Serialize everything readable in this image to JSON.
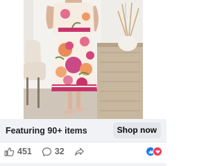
{
  "ad": {
    "headline": "Featuring 90+ items",
    "cta_label": "Shop now"
  },
  "engagement": {
    "likes": "451",
    "comments": "32",
    "reactions": [
      "like-reaction",
      "love-reaction"
    ]
  },
  "icons": {
    "like": "thumbs-up-icon",
    "comment": "comment-icon",
    "share": "share-icon"
  },
  "colors": {
    "cta_bar_bg": "#f0f2f5",
    "text_primary": "#1c1e21",
    "text_secondary": "#65676b",
    "like_blue": "#1877f2",
    "love_red": "#f33e58"
  }
}
